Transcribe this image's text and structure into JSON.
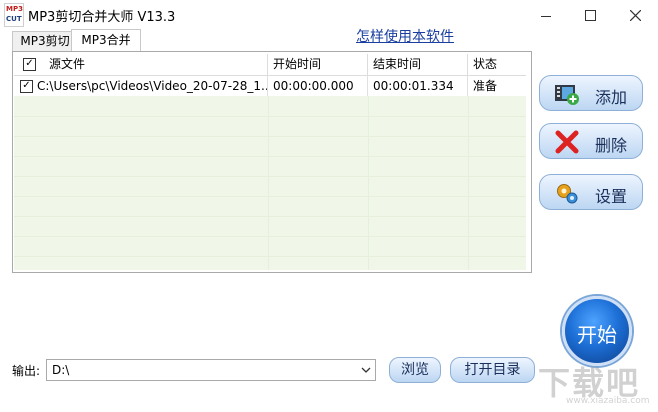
{
  "window": {
    "title": "MP3剪切合并大师 V13.3",
    "icon_top": "MP3",
    "icon_bottom": "CUT"
  },
  "tabs": [
    {
      "label": "MP3剪切",
      "active": false
    },
    {
      "label": "MP3合并",
      "active": true
    }
  ],
  "help_link": "怎样使用本软件",
  "table": {
    "header_checked": true,
    "columns": [
      "源文件",
      "开始时间",
      "结束时间",
      "状态"
    ],
    "rows": [
      {
        "checked": true,
        "source": "C:\\Users\\pc\\Videos\\Video_20-07-28_1...",
        "start": "00:00:00.000",
        "end": "00:00:01.334",
        "status": "准备"
      }
    ]
  },
  "side_buttons": {
    "add": "添加",
    "delete": "删除",
    "settings": "设置"
  },
  "start_button": "开始",
  "output": {
    "label": "输出:",
    "value": "D:\\"
  },
  "buttons": {
    "browse": "浏览",
    "open_dir": "打开目录"
  },
  "watermark": {
    "text": "下载吧",
    "sub": "www.xiazaiba.com"
  },
  "icons": {
    "add": "film-add-icon",
    "delete": "red-x-icon",
    "settings": "gears-icon"
  },
  "colors": {
    "table_bg": "#f0f7e8",
    "link": "#1a3fa0",
    "start": "#1d6fd6"
  }
}
